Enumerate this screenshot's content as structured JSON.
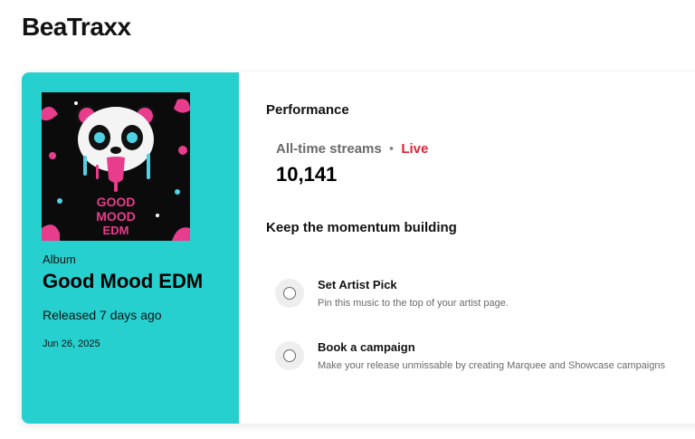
{
  "header": {
    "app_title": "BeaTraxx"
  },
  "release": {
    "type": "Album",
    "title": "Good Mood EDM",
    "released": "Released 7 days ago",
    "date": "Jun 26, 2025",
    "cover_text": [
      "GOOD",
      "MOOD",
      "EDM"
    ],
    "panel_color": "#26d0ce"
  },
  "performance": {
    "heading": "Performance",
    "streams_label": "All-time streams",
    "separator": "•",
    "live_label": "Live",
    "streams_value": "10,141",
    "live_color": "#e22134"
  },
  "momentum": {
    "heading": "Keep the momentum building",
    "actions": [
      {
        "title": "Set Artist Pick",
        "description": "Pin this music to the top of your artist page."
      },
      {
        "title": "Book a campaign",
        "description": "Make your release unmissable by creating Marquee and Showcase campaigns"
      }
    ]
  }
}
